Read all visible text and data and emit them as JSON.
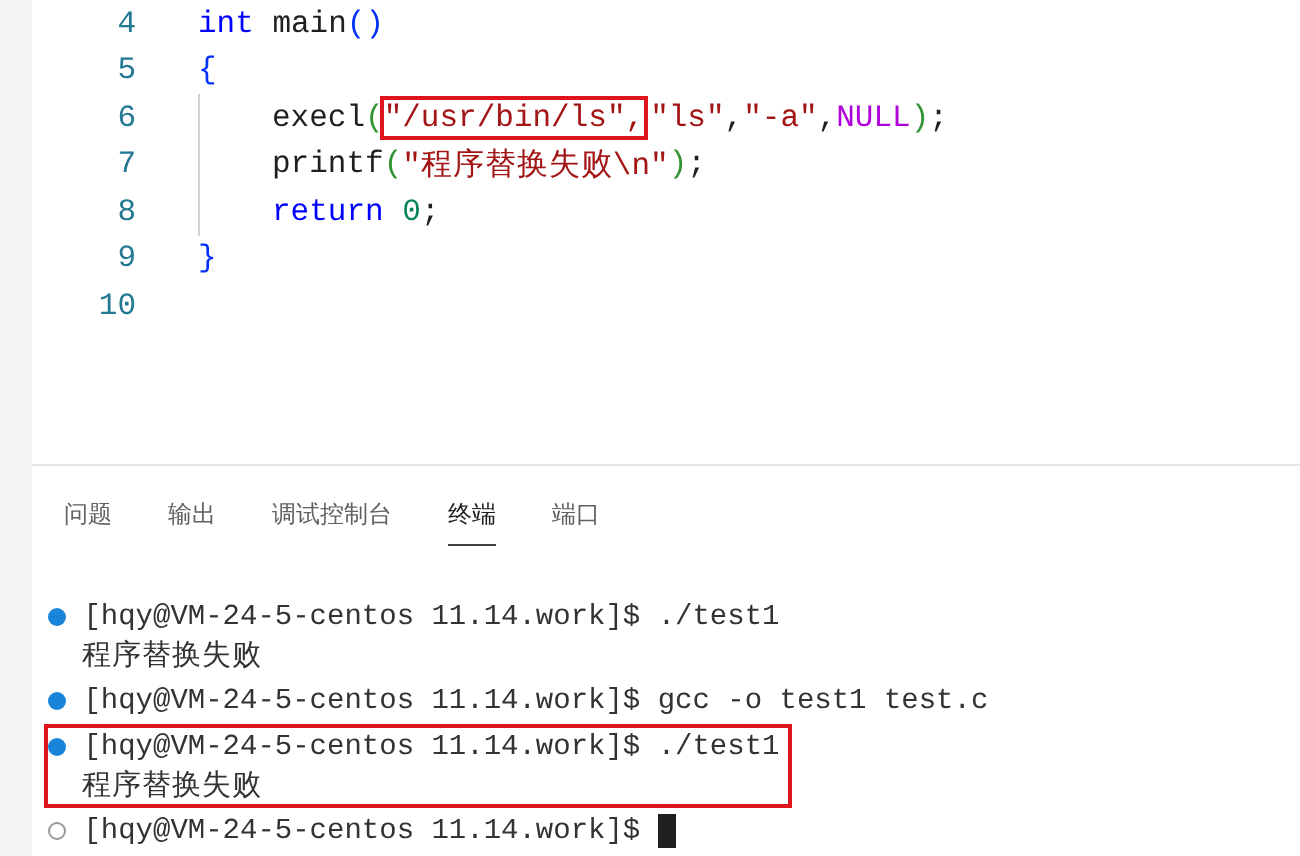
{
  "editor": {
    "lines": [
      {
        "number": "4",
        "indented": false,
        "tokens": [
          {
            "text": "int",
            "kind": "keyword"
          },
          {
            "text": " main",
            "kind": "ident"
          },
          {
            "text": "()",
            "kind": "bracket1"
          }
        ]
      },
      {
        "number": "5",
        "indented": false,
        "tokens": [
          {
            "text": "{",
            "kind": "bracket1"
          }
        ]
      },
      {
        "number": "6",
        "indented": true,
        "tokens": [
          {
            "text": "execl",
            "kind": "ident"
          },
          {
            "text": "(",
            "kind": "bracket2"
          },
          {
            "text": "\"/usr/bin/ls\",",
            "kind": "string",
            "highlighted": true
          },
          {
            "text": "\"ls\"",
            "kind": "string"
          },
          {
            "text": ",",
            "kind": "ident"
          },
          {
            "text": "\"-a\"",
            "kind": "string"
          },
          {
            "text": ",",
            "kind": "ident"
          },
          {
            "text": "NULL",
            "kind": "macro"
          },
          {
            "text": ")",
            "kind": "bracket2"
          },
          {
            "text": ";",
            "kind": "ident"
          }
        ]
      },
      {
        "number": "7",
        "indented": true,
        "tokens": [
          {
            "text": "printf",
            "kind": "ident"
          },
          {
            "text": "(",
            "kind": "bracket2"
          },
          {
            "text": "\"程序替换失败\\n\"",
            "kind": "string"
          },
          {
            "text": ")",
            "kind": "bracket2"
          },
          {
            "text": ";",
            "kind": "ident"
          }
        ]
      },
      {
        "number": "8",
        "indented": true,
        "tokens": [
          {
            "text": "return ",
            "kind": "keyword"
          },
          {
            "text": "0",
            "kind": "number"
          },
          {
            "text": ";",
            "kind": "ident"
          }
        ]
      },
      {
        "number": "9",
        "indented": false,
        "tokens": [
          {
            "text": "}",
            "kind": "bracket1"
          }
        ]
      },
      {
        "number": "10",
        "indented": false
      }
    ]
  },
  "panel": {
    "tabs": [
      {
        "label": "问题",
        "selected": false
      },
      {
        "label": "输出",
        "selected": false
      },
      {
        "label": "调试控制台",
        "selected": false
      },
      {
        "label": "终端",
        "selected": true
      },
      {
        "label": "端口",
        "selected": false
      }
    ]
  },
  "terminal": {
    "entries": [
      {
        "kind": "done",
        "prompt": "[hqy@VM-24-5-centos 11.14.work]$",
        "command": "./test1",
        "output": "程序替换失败",
        "highlighted": false
      },
      {
        "kind": "done",
        "prompt": "[hqy@VM-24-5-centos 11.14.work]$",
        "command": "gcc -o test1 test.c",
        "highlighted": false
      },
      {
        "kind": "done",
        "prompt": "[hqy@VM-24-5-centos 11.14.work]$",
        "command": "./test1",
        "output": "程序替换失败",
        "highlighted": true
      },
      {
        "kind": "pending",
        "prompt": "[hqy@VM-24-5-centos 11.14.work]$",
        "highlighted": false
      }
    ]
  }
}
